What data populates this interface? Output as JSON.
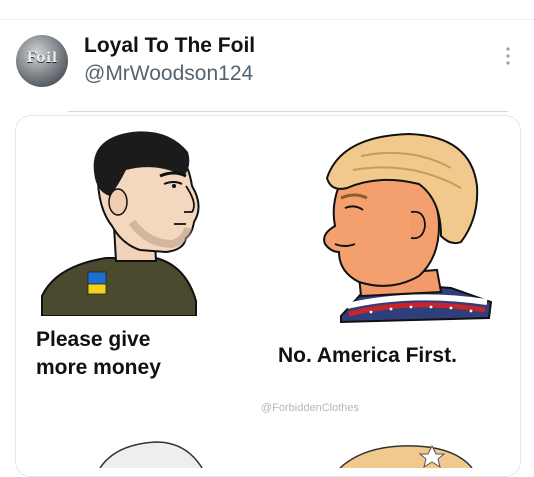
{
  "tweet": {
    "display_name": "Loyal To The Foil",
    "handle": "@MrWoodson124",
    "avatar_text": "Foil",
    "avatar_icon": "foil-logo-avatar",
    "more_icon": "more-vertical-icon"
  },
  "meme": {
    "left_caption": "Please give more money",
    "right_caption": "No. America First.",
    "watermark": "@ForbiddenClothes",
    "left_figure_icon": "soldier-with-ukraine-patch",
    "right_figure_icon": "blonde-man-with-flag-scarf",
    "patch_colors": [
      "#1f6fd1",
      "#f3d21a"
    ]
  }
}
